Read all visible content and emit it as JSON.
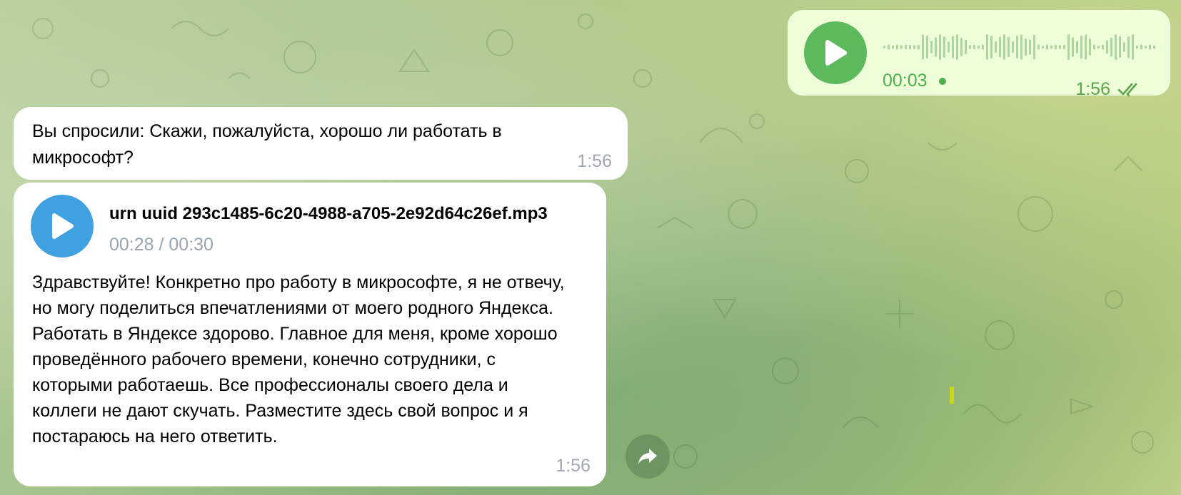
{
  "chat": {
    "outgoing_voice": {
      "duration": "00:03",
      "time": "1:56",
      "status": "read",
      "accent_color": "#5cba5c",
      "icons": {
        "play": "play-icon",
        "status": "double-check-icon"
      }
    },
    "question_message": {
      "text": "Вы спросили: Скажи, пожалуйста, хорошо ли работать в микрософт?",
      "time": "1:56"
    },
    "answer_message": {
      "audio": {
        "filename": "urn uuid 293c1485-6c20-4988-a705-2e92d64c26ef.mp3",
        "progress": "00:28 / 00:30",
        "accent_color": "#3fa1e0"
      },
      "text": "Здравствуйте! Конкретно про работу в микрософте, я не отвечу, но могу поделиться впечатлениями от моего родного Яндекса. Работать в Яндексе здорово. Главное для меня, кроме хорошо проведённого рабочего времени, конечно сотрудники, с которыми работаешь. Все профессионалы своего дела и коллеги не дают скучать. Разместите здесь свой вопрос и я постараюсь на него ответить.",
      "time": "1:56"
    },
    "forward_button": {
      "icon": "forward-arrow-icon"
    },
    "colors": {
      "incoming_bubble": "#ffffff",
      "outgoing_bubble": "#eefed8"
    }
  }
}
